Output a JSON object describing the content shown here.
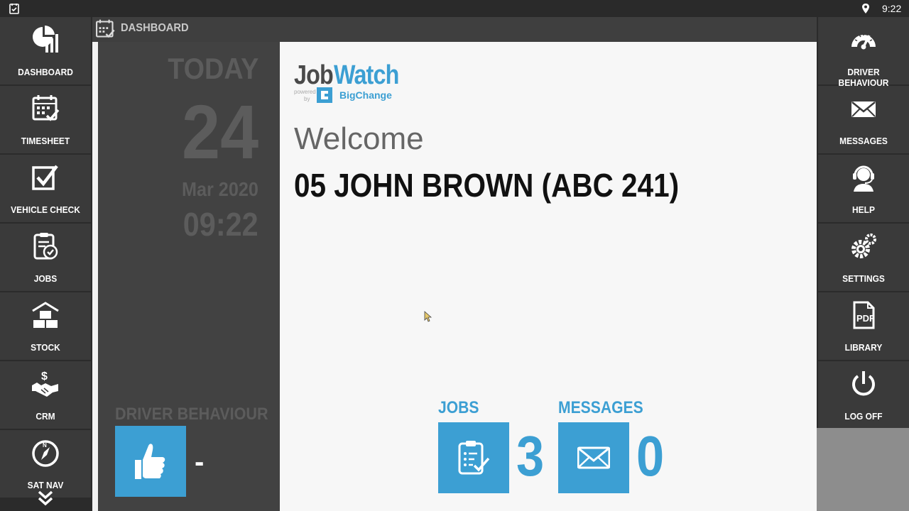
{
  "status_bar": {
    "time": "9:22"
  },
  "header": {
    "title": "DASHBOARD"
  },
  "left_nav": [
    {
      "label": "DASHBOARD",
      "icon": "dashboard-chart-icon"
    },
    {
      "label": "TIMESHEET",
      "icon": "calendar-check-icon"
    },
    {
      "label": "VEHICLE CHECK",
      "icon": "checkbox-icon"
    },
    {
      "label": "JOBS",
      "icon": "clipboard-check-icon"
    },
    {
      "label": "STOCK",
      "icon": "boxes-icon"
    },
    {
      "label": "CRM",
      "icon": "handshake-dollar-icon"
    },
    {
      "label": "SAT NAV",
      "icon": "compass-icon"
    }
  ],
  "right_nav": [
    {
      "label": "DRIVER BEHAVIOUR",
      "icon": "speedometer-icon"
    },
    {
      "label": "MESSAGES",
      "icon": "envelope-icon"
    },
    {
      "label": "HELP",
      "icon": "headset-icon"
    },
    {
      "label": "SETTINGS",
      "icon": "gears-icon"
    },
    {
      "label": "LIBRARY",
      "icon": "pdf-icon"
    },
    {
      "label": "LOG OFF",
      "icon": "power-icon"
    }
  ],
  "date_panel": {
    "today_label": "TODAY",
    "day": "24",
    "month_year": "Mar 2020",
    "time": "09:22",
    "driver_behaviour_label": "DRIVER BEHAVIOUR",
    "driver_behaviour_value": "-"
  },
  "main": {
    "logo_part1": "Job",
    "logo_part2": "Watch",
    "logo_powered": "powered",
    "logo_by": "by",
    "logo_brand": "BigChange",
    "welcome": "Welcome",
    "user": "05 JOHN BROWN (ABC 241)",
    "jobs_label": "JOBS",
    "jobs_count": "3",
    "messages_label": "MESSAGES",
    "messages_count": "0"
  },
  "colors": {
    "accent": "#3c9fd3",
    "nav_bg": "#3a3a3a",
    "panel_bg": "#424242",
    "main_bg": "#f7f7f7"
  }
}
